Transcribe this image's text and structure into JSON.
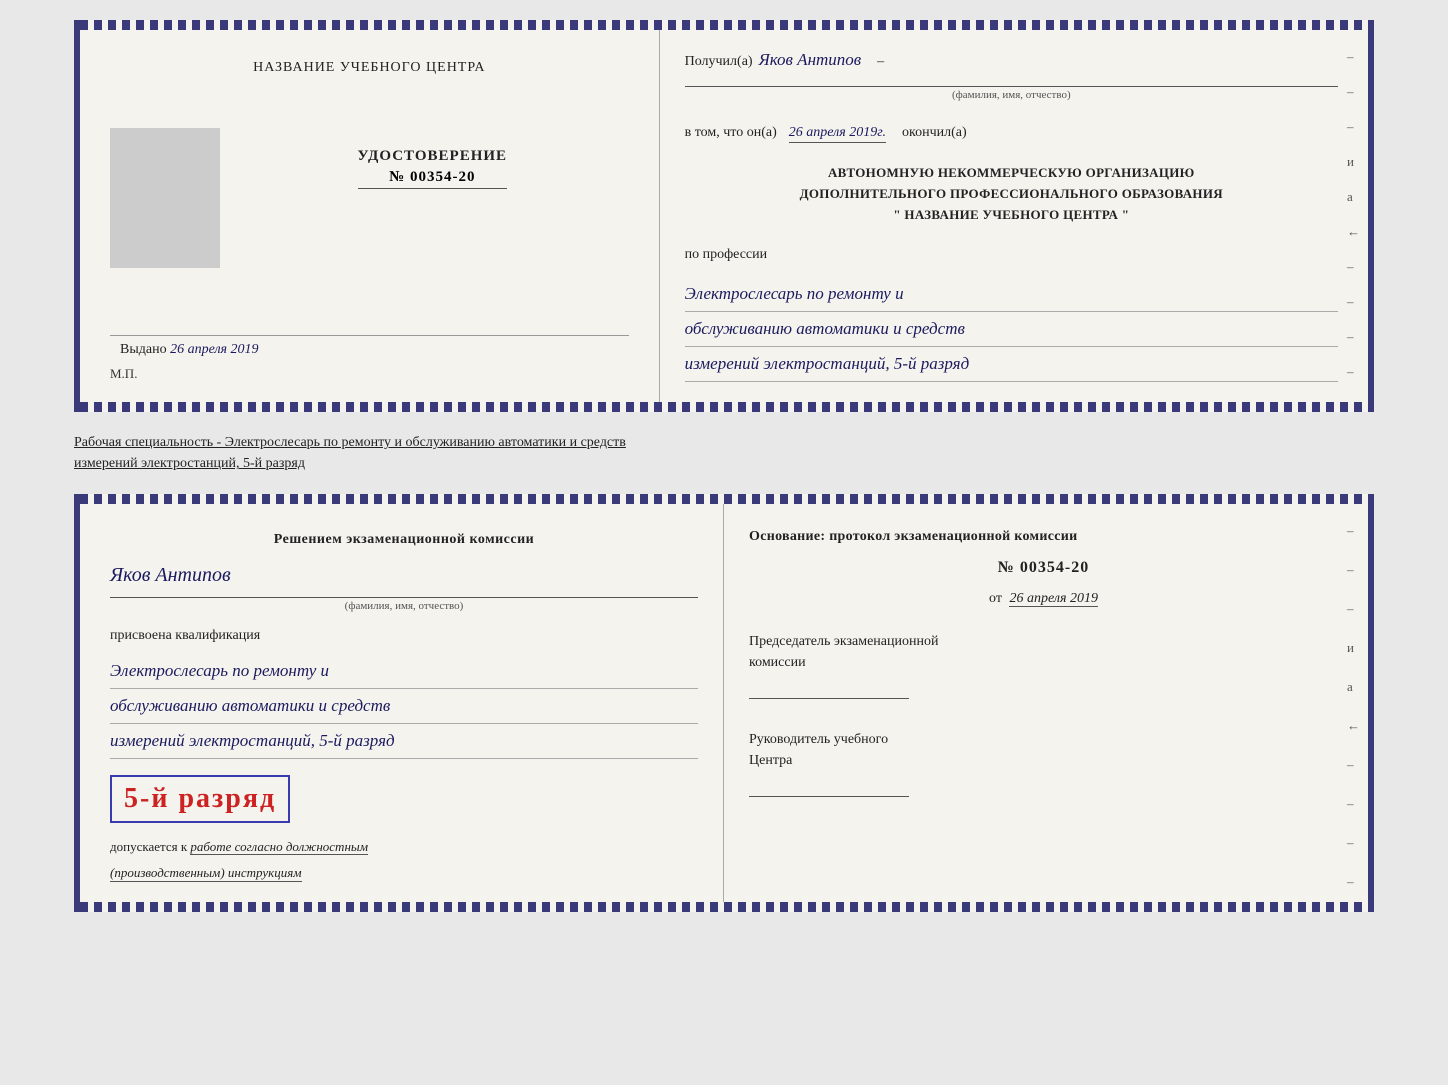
{
  "top_doc": {
    "left": {
      "center_title": "НАЗВАНИЕ УЧЕБНОГО ЦЕНТРА",
      "udostoverenie_label": "УДОСТОВЕРЕНИЕ",
      "number": "№ 00354-20",
      "vydano_label": "Выдано",
      "vydano_date": "26 апреля 2019",
      "mp": "М.П."
    },
    "right": {
      "poluchil_label": "Получил(а)",
      "poluchil_name": "Яков Антипов",
      "fio_sublabel": "(фамилия, имя, отчество)",
      "dash": "–",
      "vtom_prefix": "в том, что он(а)",
      "vtom_date": "26 апреля 2019г.",
      "okончил": "окончил(а)",
      "org_line1": "АВТОНОМНУЮ НЕКОММЕРЧЕСКУЮ ОРГАНИЗАЦИЮ",
      "org_line2": "ДОПОЛНИТЕЛЬНОГО ПРОФЕССИОНАЛЬНОГО ОБРАЗОВАНИЯ",
      "org_line3": "\"  НАЗВАНИЕ УЧЕБНОГО ЦЕНТРА  \"",
      "po_professii": "по профессии",
      "prof_line1": "Электрослесарь по ремонту и",
      "prof_line2": "обслуживанию автоматики и средств",
      "prof_line3": "измерений электростанций, 5-й разряд",
      "right_dashes": [
        "-",
        "-",
        "-",
        "и",
        "а",
        "←",
        "-",
        "-",
        "-",
        "-"
      ]
    }
  },
  "between_label": {
    "line1": "Рабочая специальность - Электрослесарь по ремонту и обслуживанию автоматики и средств",
    "line2": "измерений электростанций, 5-й разряд"
  },
  "bottom_doc": {
    "left": {
      "resheniem_label": "Решением  экзаменационной  комиссии",
      "name_handwritten": "Яков Антипов",
      "fio_sublabel": "(фамилия, имя, отчество)",
      "prisvoena_label": "присвоена квалификация",
      "qual_line1": "Электрослесарь по ремонту и",
      "qual_line2": "обслуживанию автоматики и средств",
      "qual_line3": "измерений электростанций, 5-й разряд",
      "grade_text": "5-й разряд",
      "dopuskaetsya_prefix": "допускается к",
      "dopusk_italic": "работе согласно должностным",
      "dopusk_italic2": "(производственным) инструкциям"
    },
    "right": {
      "osnovaniye_label": "Основание: протокол экзаменационной комиссии",
      "protocol_number": "№  00354-20",
      "ot_label": "от",
      "ot_date": "26 апреля 2019",
      "predsedatel_line1": "Председатель экзаменационной",
      "predsedatel_line2": "комиссии",
      "rukovoditel_line1": "Руководитель учебного",
      "rukovoditel_line2": "Центра",
      "right_dashes": [
        "-",
        "-",
        "-",
        "и",
        "а",
        "←",
        "-",
        "-",
        "-",
        "-"
      ]
    }
  }
}
